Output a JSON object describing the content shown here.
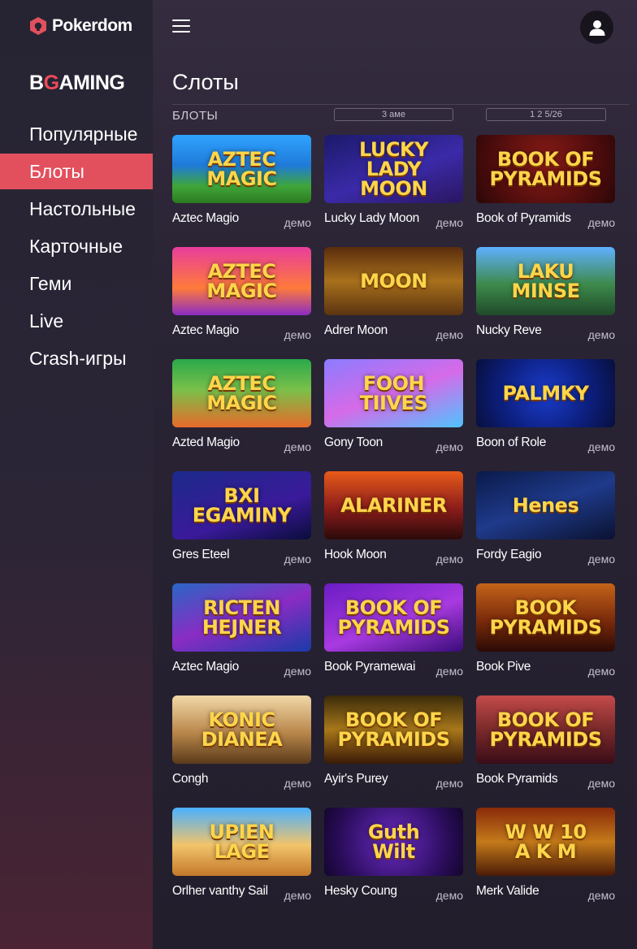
{
  "brand": {
    "name": "Pokerdom",
    "accent": "#e2505e"
  },
  "provider": {
    "prefix": "B",
    "highlight": "G",
    "suffix": "AMING"
  },
  "sidebar": {
    "items": [
      {
        "label": "Популярные",
        "active": false
      },
      {
        "label": "Блоты",
        "active": true
      },
      {
        "label": "Настольные",
        "active": false
      },
      {
        "label": "Карточные",
        "active": false
      },
      {
        "label": "Геми",
        "active": false
      },
      {
        "label": "Live",
        "active": false
      },
      {
        "label": "Crash-игры",
        "active": false
      }
    ]
  },
  "header": {
    "menu_icon": "hamburger-icon",
    "user_icon": "user-icon"
  },
  "main": {
    "title": "Слоты",
    "sub_label": "БЛОТЫ",
    "filter_a": "3 aмe",
    "filter_b": "1 2 5/26"
  },
  "games": [
    {
      "name": "Aztec Magio",
      "demo": "демо",
      "thumb_text": "AZTEC\nMAGIC"
    },
    {
      "name": "Lucky Lady Moon",
      "demo": "демо",
      "thumb_text": "LUCKY\nLADY\nMOON"
    },
    {
      "name": "Book of Pyramids",
      "demo": "демо",
      "thumb_text": "BOOK OF\nPYRAMIDS"
    },
    {
      "name": "Aztec Magio",
      "demo": "демо",
      "thumb_text": "AZTEC\nMAGIC"
    },
    {
      "name": "Adrer Moon",
      "demo": "демо",
      "thumb_text": "MOON"
    },
    {
      "name": "Nucky Reve",
      "demo": "демо",
      "thumb_text": "LAKU\nMINSE"
    },
    {
      "name": "Azted Magio",
      "demo": "демо",
      "thumb_text": "AZTEC\nMAGIC"
    },
    {
      "name": "Gony Toon",
      "demo": "демо",
      "thumb_text": "FOOH\nTIIVES"
    },
    {
      "name": "Boon of Role",
      "demo": "демо",
      "thumb_text": "PALMKY"
    },
    {
      "name": "Gres Eteel",
      "demo": "демо",
      "thumb_text": "BXI\nEGAMINY"
    },
    {
      "name": "Hook Moon",
      "demo": "демо",
      "thumb_text": "ALARINER"
    },
    {
      "name": "Fordy Eagio",
      "demo": "демо",
      "thumb_text": "Henes"
    },
    {
      "name": "Aztec Magio",
      "demo": "демо",
      "thumb_text": "RICTEN\nHEJNER"
    },
    {
      "name": "Book Pyramewai",
      "demo": "демо",
      "thumb_text": "BOOK OF\nPYRAMIDS"
    },
    {
      "name": "Book Pive",
      "demo": "демо",
      "thumb_text": "BOOK\nPYRAMIDS"
    },
    {
      "name": "Congh",
      "demo": "демо",
      "thumb_text": "KONIC\nDIANEA"
    },
    {
      "name": "Ayir's Purey",
      "demo": "демо",
      "thumb_text": "BOOK OF\nPYRAMIDS"
    },
    {
      "name": "Book Pyramids",
      "demo": "демо",
      "thumb_text": "BOOK OF\nPYRAMIDS"
    },
    {
      "name": "Orlher vanthy Sail",
      "demo": "демо",
      "thumb_text": "UPIEN\nLAGE"
    },
    {
      "name": "Hesky Coung",
      "demo": "демо",
      "thumb_text": "Guth\nWilt"
    },
    {
      "name": "Merk Valide",
      "demo": "демо",
      "thumb_text": "W W 10\nA K M"
    }
  ]
}
